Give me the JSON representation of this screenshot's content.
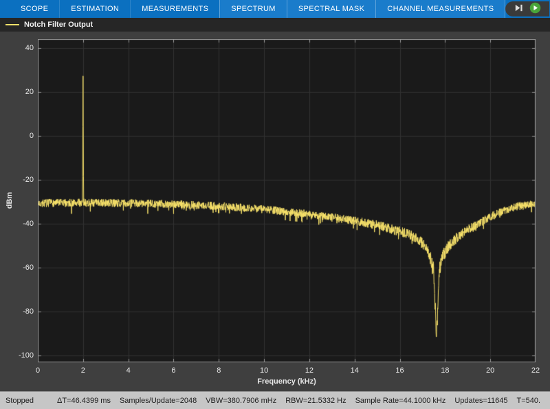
{
  "tabbar": {
    "background": "#0b70c0",
    "context_background": "#1a7ccb",
    "tabs": [
      {
        "label": "SCOPE"
      },
      {
        "label": "ESTIMATION"
      },
      {
        "label": "MEASUREMENTS"
      },
      {
        "label": "SPECTRUM"
      },
      {
        "label": "SPECTRAL MASK"
      },
      {
        "label": "CHANNEL MEASUREMENTS"
      }
    ],
    "run_button_color": "#49a53a"
  },
  "icons": {
    "more": "⋯"
  },
  "legend": {
    "series_label": "Notch Filter Output",
    "line_color": "#f8e26a"
  },
  "status": {
    "state": "Stopped",
    "items": [
      "ΔT=46.4399 ms",
      "Samples/Update=2048",
      "VBW=380.7906 mHz",
      "RBW=21.5332 Hz",
      "Sample Rate=44.1000 kHz",
      "Updates=11645",
      "T=540."
    ]
  },
  "chart_data": {
    "type": "line",
    "title": "",
    "xlabel": "Frequency (kHz)",
    "ylabel": "dBm",
    "xlim": [
      0,
      22
    ],
    "ylim": [
      -103,
      44
    ],
    "xticks": [
      0,
      2,
      4,
      6,
      8,
      10,
      12,
      14,
      16,
      18,
      20,
      22
    ],
    "yticks": [
      40,
      20,
      0,
      -20,
      -40,
      -60,
      -80,
      -100
    ],
    "grid": true,
    "legend_position": "top-bar",
    "series": [
      {
        "name": "Notch Filter Output",
        "color": "#f8e26a",
        "noise_db": 1.8,
        "peak": {
          "freq_khz": 2.0,
          "level_dbm": 27
        },
        "notch": {
          "freq_khz": 17.62,
          "level_dbm": -91
        },
        "envelope_dbm": [
          [
            0,
            -30.6
          ],
          [
            1,
            -30.5
          ],
          [
            2,
            -30.4
          ],
          [
            3,
            -30.5
          ],
          [
            4,
            -30.6
          ],
          [
            5,
            -30.8
          ],
          [
            6,
            -31.0
          ],
          [
            7,
            -31.5
          ],
          [
            8,
            -32.0
          ],
          [
            9,
            -32.6
          ],
          [
            10,
            -33.4
          ],
          [
            11,
            -34.4
          ],
          [
            12,
            -35.6
          ],
          [
            13,
            -37.0
          ],
          [
            14,
            -38.6
          ],
          [
            15,
            -40.6
          ],
          [
            16,
            -43.4
          ],
          [
            16.5,
            -45.4
          ],
          [
            17.0,
            -48.8
          ],
          [
            17.3,
            -53.5
          ],
          [
            17.5,
            -61.0
          ],
          [
            17.62,
            -91.0
          ],
          [
            17.75,
            -61.0
          ],
          [
            17.9,
            -54.5
          ],
          [
            18.2,
            -49.5
          ],
          [
            18.6,
            -45.5
          ],
          [
            19.0,
            -42.5
          ],
          [
            19.5,
            -39.8
          ],
          [
            20.0,
            -36.8
          ],
          [
            20.5,
            -34.4
          ],
          [
            21.0,
            -32.6
          ],
          [
            21.5,
            -31.4
          ],
          [
            22.0,
            -30.6
          ]
        ]
      }
    ],
    "colors": {
      "figure_bg": "#3f3f3f",
      "axes_bg": "#1a1a1a",
      "grid": "#323232",
      "box": "#9b9b9b",
      "tick_text": "#e8e8e8"
    }
  }
}
